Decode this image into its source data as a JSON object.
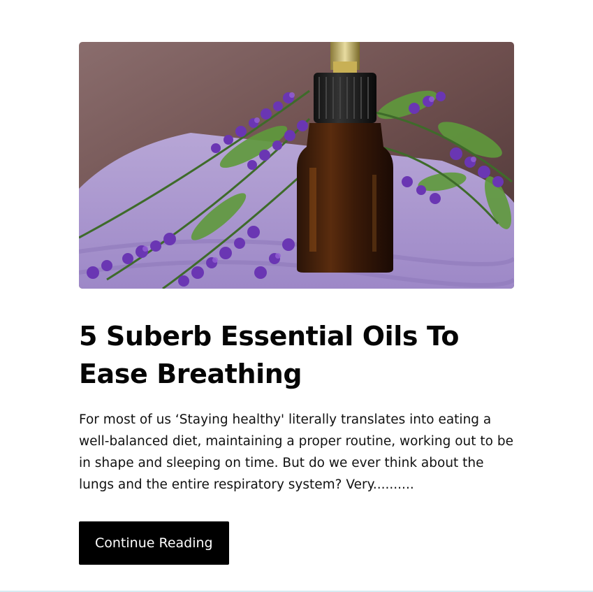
{
  "post": {
    "image_description": "lavender-essential-oil-photo",
    "title": "5 Suberb Essential Oils To Ease Breathing",
    "excerpt": "For most of us ‘Staying healthy' literally translates into eating a well-balanced diet, maintaining a proper routine, working out to be in shape and sleeping on time. But do we ever think about the lungs and the entire respiratory system? Very..........",
    "button_label": "Continue Reading"
  },
  "colors": {
    "button_bg": "#000000",
    "button_text": "#ffffff",
    "title": "#050505",
    "body_text": "#111111"
  }
}
